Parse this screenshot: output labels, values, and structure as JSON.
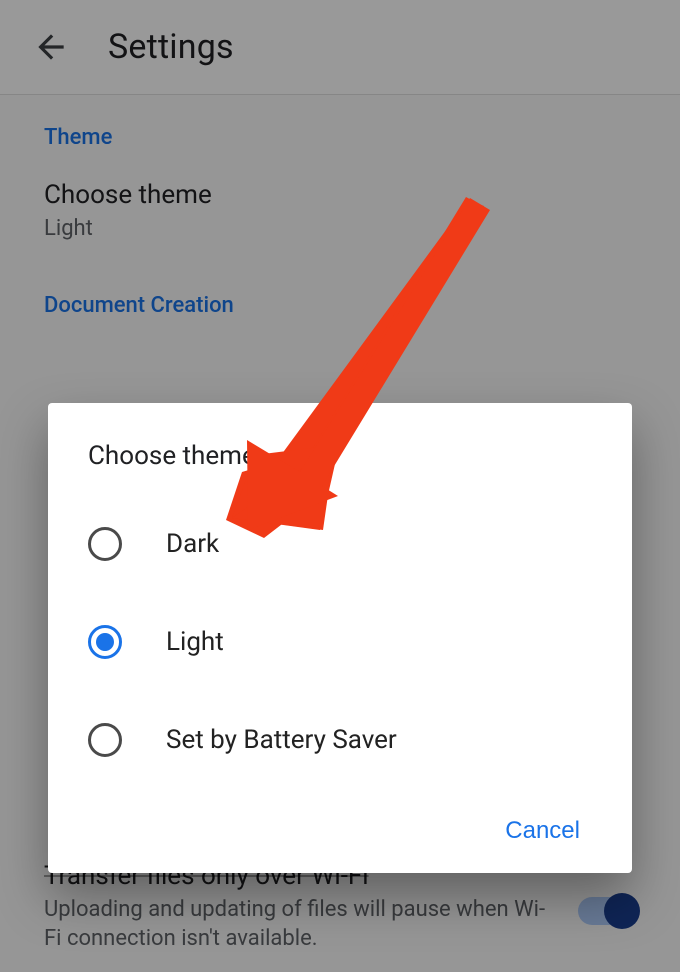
{
  "header": {
    "title": "Settings"
  },
  "sections": {
    "theme": {
      "title": "Theme",
      "setting_label": "Choose theme",
      "setting_value": "Light"
    },
    "document_creation": {
      "title": "Document Creation"
    }
  },
  "wifi_setting": {
    "title": "Transfer files only over Wi-Fi",
    "description": "Uploading and updating of files will pause when Wi-Fi connection isn't available."
  },
  "dialog": {
    "title": "Choose theme",
    "options": {
      "dark": "Dark",
      "light": "Light",
      "battery": "Set by Battery Saver"
    },
    "selected": "light",
    "cancel": "Cancel"
  },
  "colors": {
    "accent": "#1a73e8",
    "arrow": "#f03a17"
  }
}
